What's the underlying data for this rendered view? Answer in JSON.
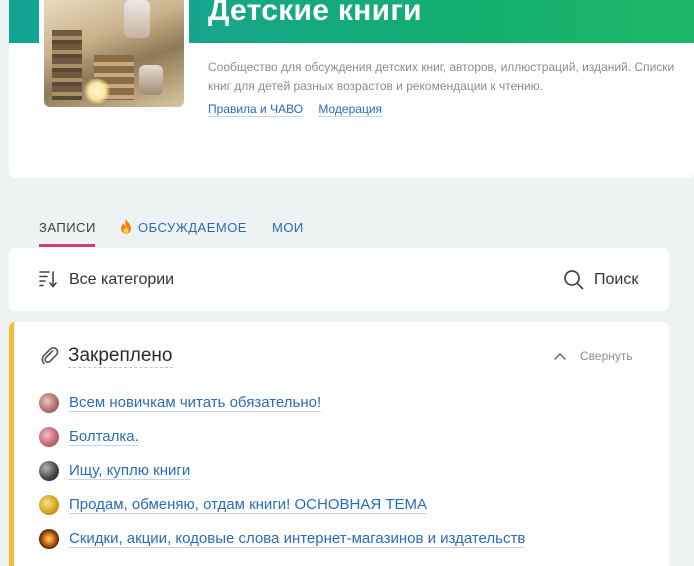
{
  "community": {
    "title": "Детские книги",
    "description": "Сообщество для обсуждения детских книг, авторов, иллюстраций, изданий. Списки книг для детей разных возрастов и рекомендации к чтению.",
    "links": [
      "Правила и ЧАВО",
      "Модерация"
    ]
  },
  "tabs": [
    {
      "label": "ЗАПИСИ",
      "active": true
    },
    {
      "label": "ОБСУЖДАЕМОЕ",
      "icon": "fire-icon"
    },
    {
      "label": "МОИ"
    }
  ],
  "filter": {
    "categories_label": "Все категории",
    "categories_icon": "sort-icon",
    "search_label": "Поиск",
    "search_icon": "search-icon"
  },
  "pinned": {
    "title": "Закреплено",
    "title_icon": "paperclip-icon",
    "collapse_label": "Свернуть",
    "collapse_icon": "chevron-up-icon",
    "topics": [
      "Всем новичкам читать обязательно!",
      "Болталка.",
      "Ищу, куплю книги",
      "Продам, обменяю, отдам книги! ОСНОВНАЯ ТЕМА",
      "Скидки, акции, кодовые слова интернет-магазинов и издательств"
    ]
  },
  "colors": {
    "banner": "#12b06c",
    "active_tab_underline": "#d63a7a",
    "link": "#2a6cb8",
    "pinned_accent": "#f4ba3a",
    "background": "#edf2f2"
  }
}
